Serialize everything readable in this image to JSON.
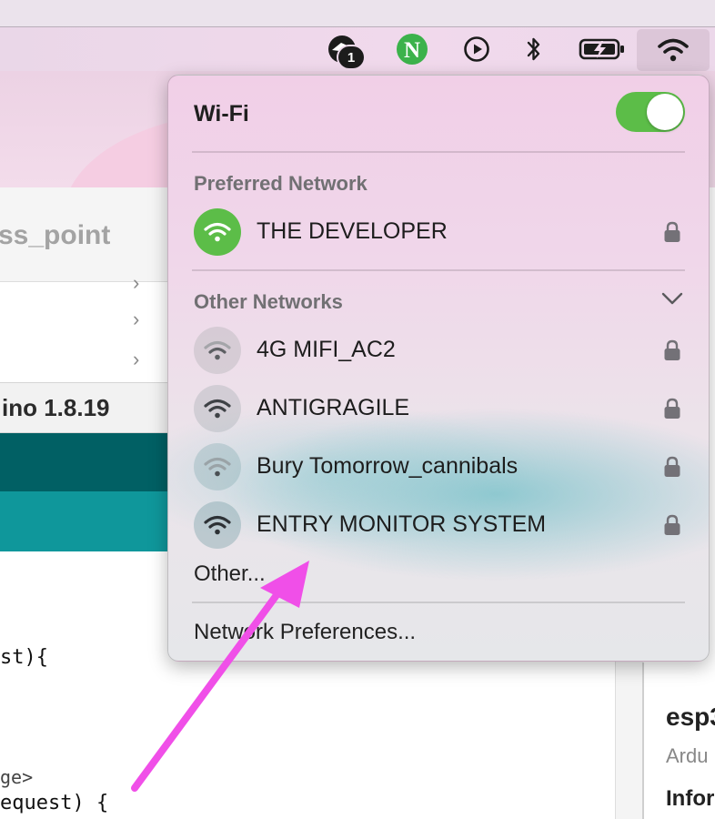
{
  "menubar": {
    "badge_count": "1",
    "icons": [
      "cloud-app-icon",
      "n-app-icon",
      "play-circle-icon",
      "bluetooth-icon",
      "battery-charging-icon",
      "wifi-icon"
    ],
    "n_app_letter": "N",
    "colors": {
      "n_app": "#3cb24b",
      "highlight": "#dcc6d8"
    }
  },
  "background_app": {
    "sketch_title": "ss_point",
    "version_label": "ino 1.8.19",
    "code_lines": [
      "st){",
      "ge>",
      "equest) {"
    ],
    "info_title": "esp3",
    "info_sub": "Ardu",
    "info_label": "Infor",
    "colors": {
      "teal_dark": "#016064",
      "teal_light": "#0f979b"
    }
  },
  "wifi_menu": {
    "title": "Wi-Fi",
    "toggle_on": true,
    "toggle_color": "#5cbd48",
    "preferred_label": "Preferred Network",
    "preferred_network": {
      "name": "THE DEVELOPER",
      "locked": true,
      "icon": "wifi-icon"
    },
    "other_label": "Other Networks",
    "other_networks": [
      {
        "name": "4G MIFI_AC2",
        "locked": true
      },
      {
        "name": "ANTIGRAGILE",
        "locked": true
      },
      {
        "name": "Bury Tomorrow_cannibals",
        "locked": true
      },
      {
        "name": "ENTRY MONITOR SYSTEM",
        "locked": true
      }
    ],
    "other_link": "Other...",
    "prefs_link": "Network Preferences..."
  },
  "annotation": {
    "color": "#f04fe8",
    "icon": "annotation-arrow-icon"
  }
}
